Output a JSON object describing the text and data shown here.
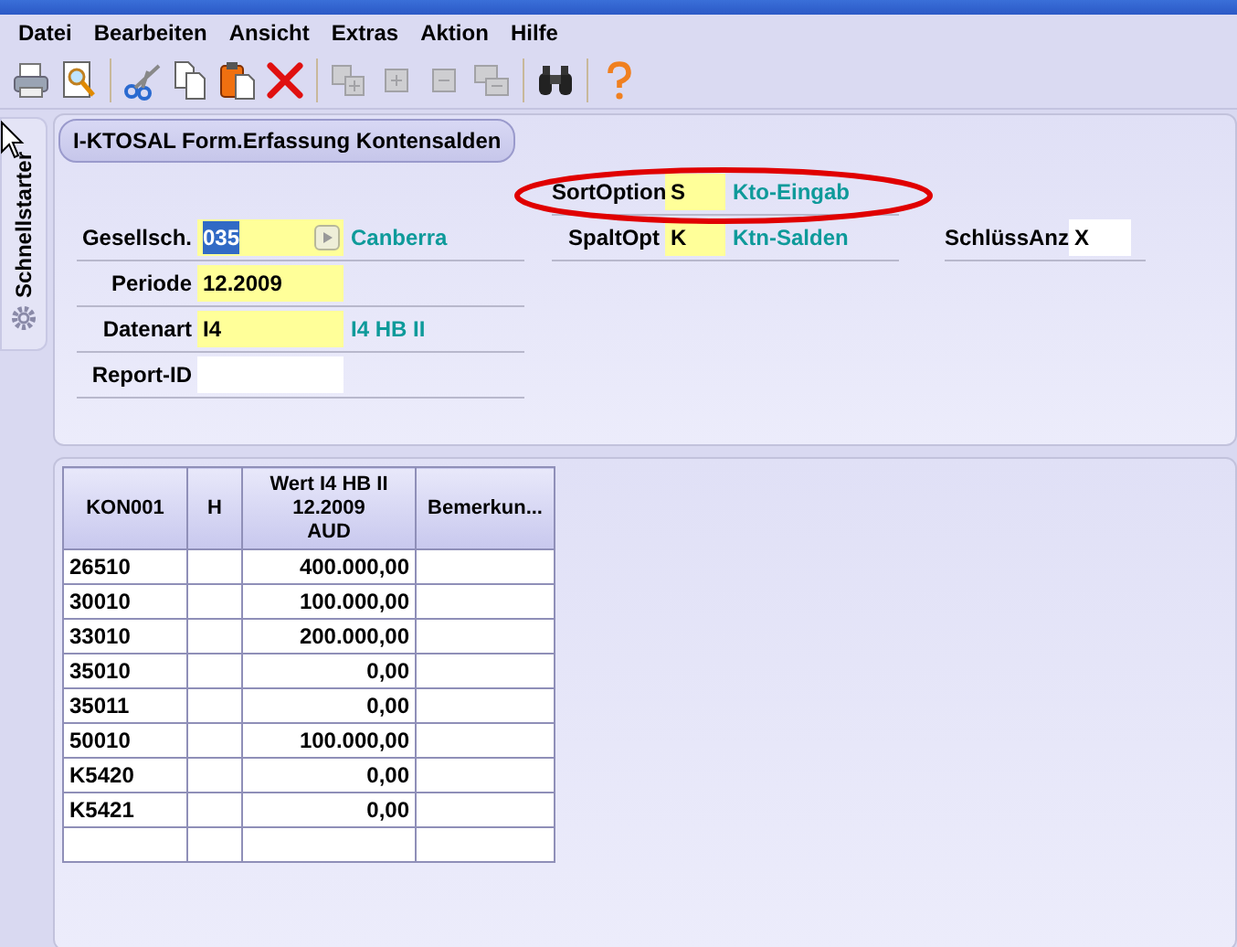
{
  "menu": [
    "Datei",
    "Bearbeiten",
    "Ansicht",
    "Extras",
    "Aktion",
    "Hilfe"
  ],
  "toolbar": [
    [
      {
        "kind": "print",
        "disabled": false
      },
      {
        "kind": "preview",
        "disabled": false
      }
    ],
    [
      {
        "kind": "cut",
        "disabled": false
      },
      {
        "kind": "copy",
        "disabled": false
      },
      {
        "kind": "paste",
        "disabled": false
      },
      {
        "kind": "delete",
        "disabled": false
      }
    ],
    [
      {
        "kind": "insert",
        "disabled": true
      },
      {
        "kind": "add",
        "disabled": true
      },
      {
        "kind": "remove",
        "disabled": true
      },
      {
        "kind": "merge",
        "disabled": true
      }
    ],
    [
      {
        "kind": "find",
        "disabled": false
      }
    ],
    [
      {
        "kind": "help",
        "disabled": false
      }
    ]
  ],
  "side_tab": {
    "label": "Schnellstarter"
  },
  "form": {
    "title": "I-KTOSAL Form.Erfassung Kontensalden",
    "rows": [
      {
        "middle": {
          "label": "SortOption",
          "value": "S",
          "required": true,
          "description": "Kto-Eingab",
          "circled": true
        }
      },
      {
        "left": {
          "label": "Gesellsch.",
          "value": "035",
          "required": true,
          "value_selected": true,
          "lookup_button": true,
          "description": "Canberra"
        },
        "middle": {
          "label": "SpaltOpt",
          "value": "K",
          "required": true,
          "description": "Ktn-Salden"
        },
        "right": {
          "label": "SchlüssAnz",
          "value": "X",
          "required": false
        }
      },
      {
        "left": {
          "label": "Periode",
          "value": "12.2009",
          "required": true
        }
      },
      {
        "left": {
          "label": "Datenart",
          "value": "I4",
          "required": true,
          "description": "I4 HB II"
        }
      },
      {
        "left": {
          "label": "Report-ID",
          "required": false
        }
      }
    ]
  },
  "table": {
    "columns": [
      {
        "label": "KON001"
      },
      {
        "label": "H"
      },
      {
        "label": "Wert I4 HB II\n12.2009\nAUD"
      },
      {
        "label": "Bemerkun..."
      }
    ],
    "rows": [
      [
        "26510",
        "",
        "400.000,00",
        ""
      ],
      [
        "30010",
        "",
        "100.000,00",
        ""
      ],
      [
        "33010",
        "",
        "200.000,00",
        ""
      ],
      [
        "35010",
        "",
        "0,00",
        ""
      ],
      [
        "35011",
        "",
        "0,00",
        ""
      ],
      [
        "50010",
        "",
        "100.000,00",
        ""
      ],
      [
        "K5420",
        "",
        "0,00",
        ""
      ],
      [
        "K5421",
        "",
        "0,00",
        ""
      ]
    ]
  }
}
